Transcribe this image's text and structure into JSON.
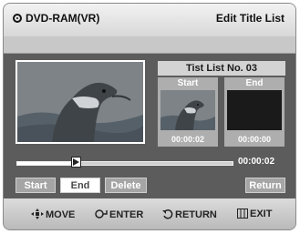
{
  "header": {
    "disc_label": "DVD-RAM(VR)",
    "title": "Edit Title List",
    "disc_icon": "disc-icon"
  },
  "preview": {
    "list_header": "Tist List No. 03",
    "start_caption": "Start",
    "start_time": "00:00:02",
    "end_caption": "End",
    "end_time": "00:00:00"
  },
  "progress": {
    "fraction": 0.27,
    "time": "00:00:02"
  },
  "buttons": {
    "start": "Start",
    "end": "End",
    "delete": "Delete",
    "return": "Return"
  },
  "footer": {
    "move": "MOVE",
    "enter": "ENTER",
    "return": "RETURN",
    "exit": "EXIT",
    "icons": [
      "move-arrows-icon",
      "enter-icon",
      "return-icon",
      "exit-icon"
    ]
  },
  "colors": {
    "panel": "#5c5c5c",
    "button": "#a5a5a5",
    "selected_button": "#ffffff"
  }
}
